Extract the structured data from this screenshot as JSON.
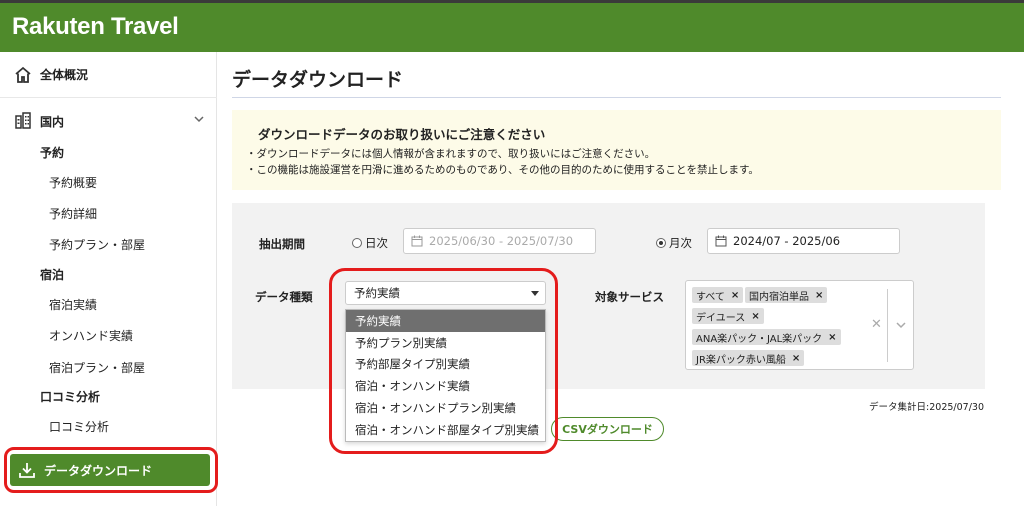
{
  "app": {
    "brand": "Rakuten Travel"
  },
  "sidebar": {
    "overview": "全体概況",
    "domestic": "国内",
    "sections": [
      {
        "title": "予約",
        "items": [
          "予約概要",
          "予約詳細",
          "予約プラン・部屋"
        ]
      },
      {
        "title": "宿泊",
        "items": [
          "宿泊実績",
          "オンハンド実績",
          "宿泊プラン・部屋"
        ]
      },
      {
        "title": "口コミ分析",
        "items": [
          "口コミ分析"
        ]
      }
    ],
    "download": "データダウンロード"
  },
  "page": {
    "title": "データダウンロード",
    "notice": {
      "heading": "ダウンロードデータのお取り扱いにご注意ください",
      "line1": "・ダウンロードデータには個人情報が含まれますので、取り扱いにはご注意ください。",
      "line2": "・この機能は施設運営を円滑に進めるためのものであり、その他の目的のために使用することを禁止します。"
    },
    "filter": {
      "period_label": "抽出期間",
      "daily_label": "日次",
      "daily_value": "2025/06/30 - 2025/07/30",
      "monthly_label": "月次",
      "monthly_value": "2024/07 - 2025/06",
      "selected_mode": "monthly",
      "data_type_label": "データ種類",
      "data_type_value": "予約実績",
      "data_type_options": [
        "予約実績",
        "予約プラン別実績",
        "予約部屋タイプ別実績",
        "宿泊・オンハンド実績",
        "宿泊・オンハンドプラン別実績",
        "宿泊・オンハンド部屋タイプ別実績"
      ],
      "service_label": "対象サービス",
      "services": [
        "すべて",
        "国内宿泊単品",
        "デイユース",
        "ANA楽パック・JAL楽パック",
        "JR楽パック赤い風船"
      ]
    },
    "aggregation_date": "データ集計日:2025/07/30",
    "csv_button": "CSVダウンロード"
  },
  "colors": {
    "brand_green": "#4f8a2b",
    "highlight_red": "#e41c1c",
    "selected_option": "#6f6f6f"
  }
}
